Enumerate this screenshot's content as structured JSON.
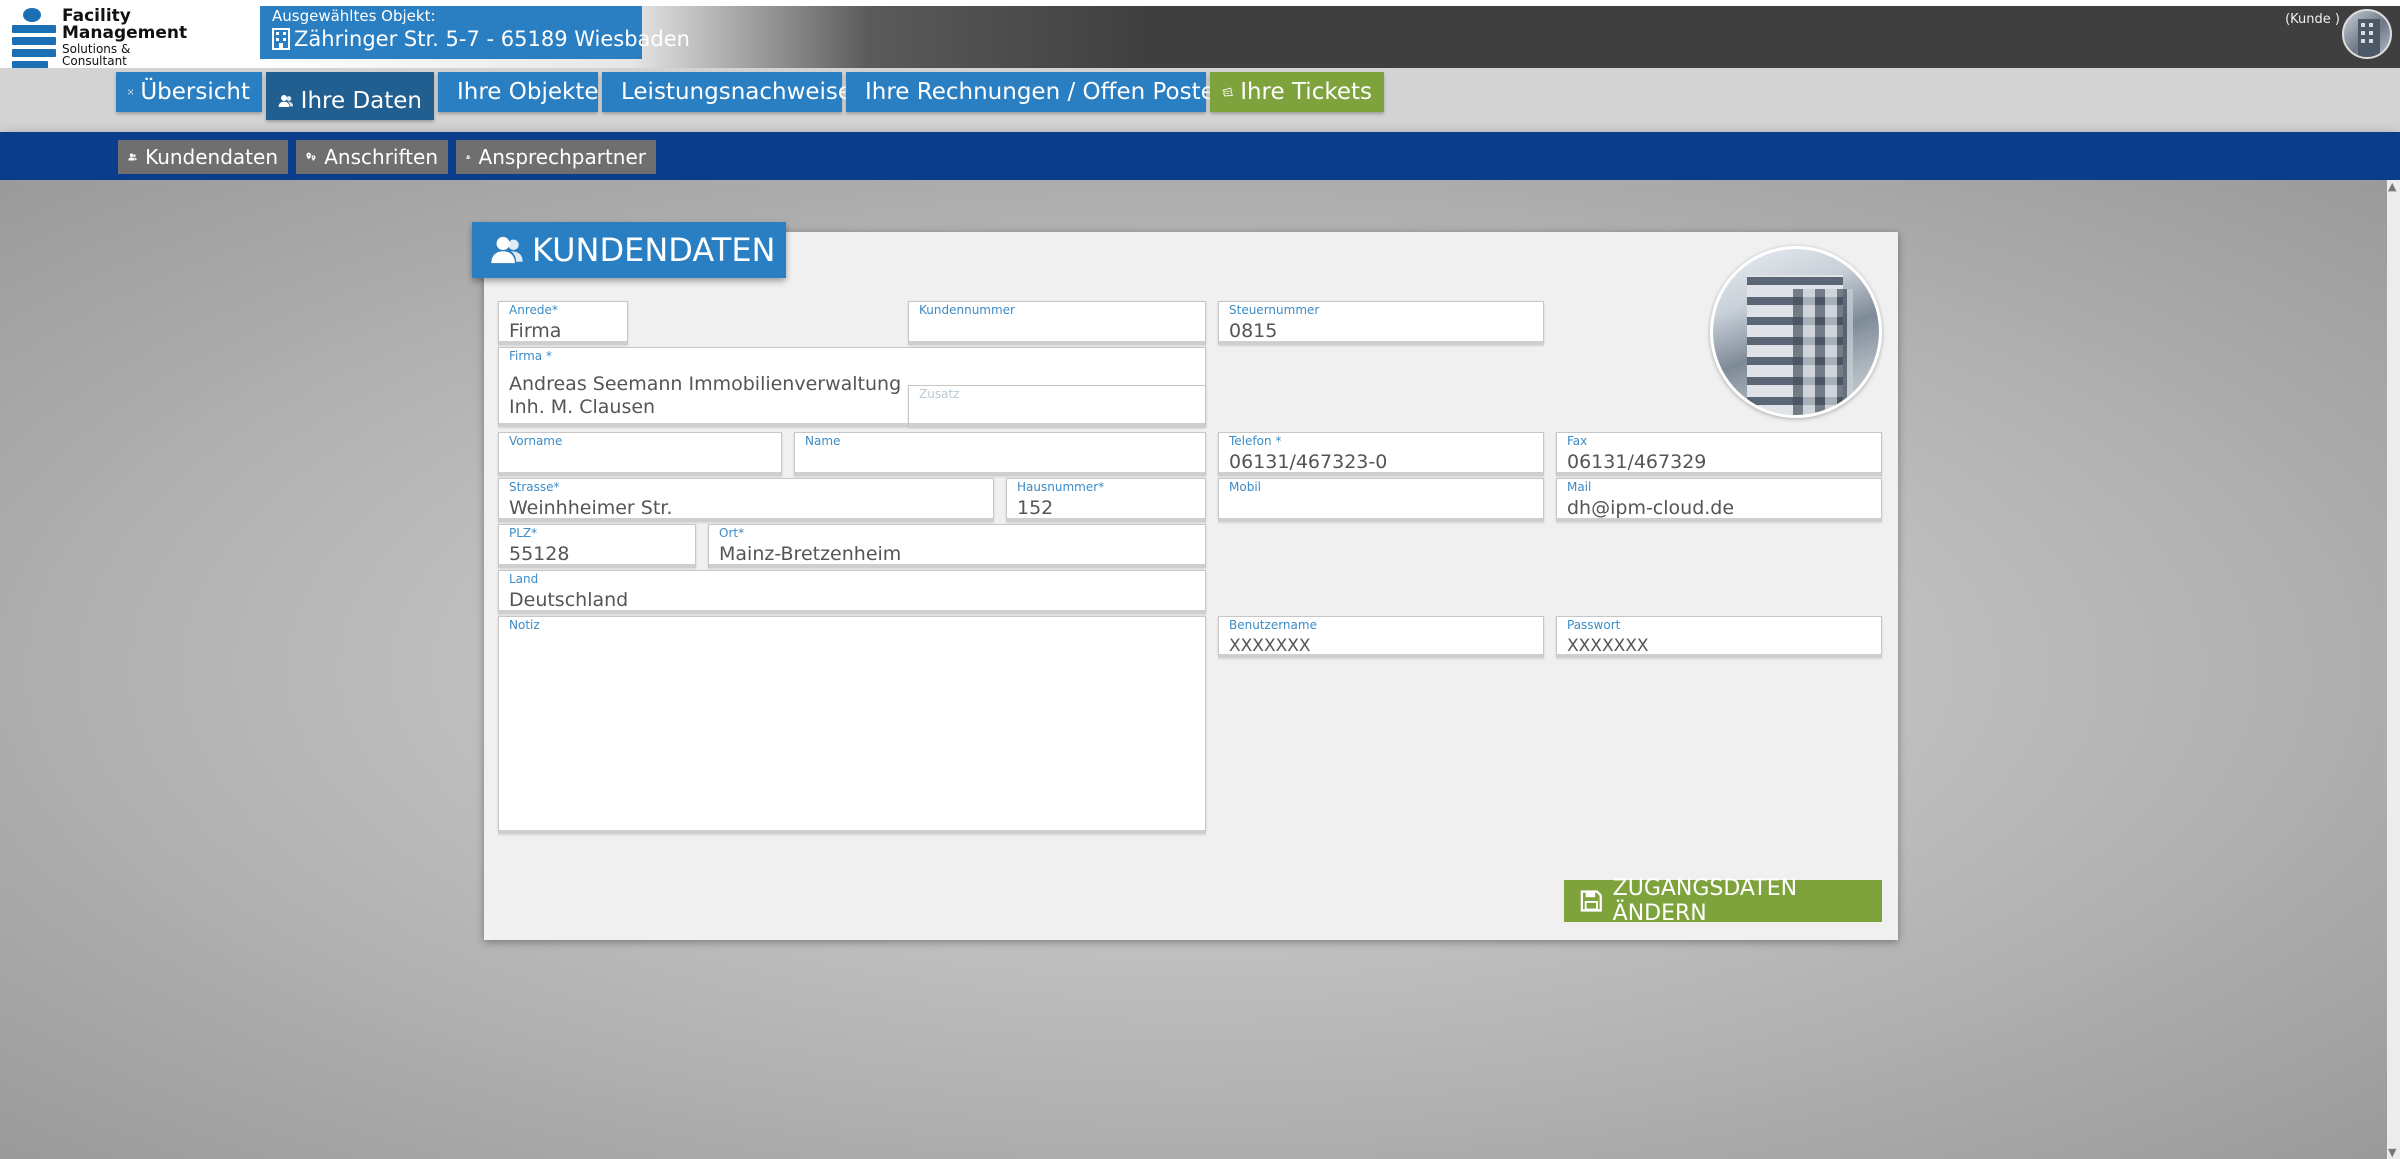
{
  "header": {
    "logo": {
      "line1": "Facility",
      "line2": "Management",
      "line3": "Solutions &",
      "line4": "Consultant"
    },
    "selected_object": {
      "label": "Ausgewähltes Objekt:",
      "value": "Zähringer Str. 5-7 - 65189 Wiesbaden"
    },
    "user_label": "(Kunde )"
  },
  "main_nav": {
    "tabs": [
      {
        "label": "Übersicht",
        "icon": "network-icon"
      },
      {
        "label": "Ihre Daten",
        "icon": "users-icon",
        "active": true
      },
      {
        "label": "Ihre Objekte",
        "icon": "building-icon"
      },
      {
        "label": "Leistungsnachweise",
        "icon": "document-icon"
      },
      {
        "label": "Ihre Rechnungen / Offen Posten",
        "icon": "coins-icon"
      },
      {
        "label": "Ihre Tickets",
        "icon": "ticket-icon"
      }
    ]
  },
  "sub_nav": {
    "tabs": [
      {
        "label": "Kundendaten",
        "icon": "users-icon"
      },
      {
        "label": "Anschriften",
        "icon": "map-pin-icon"
      },
      {
        "label": "Ansprechpartner",
        "icon": "users-icon"
      }
    ]
  },
  "panel": {
    "title": "KUNDENDATEN",
    "fields": {
      "anrede": {
        "label": "Anrede*",
        "value": "Firma"
      },
      "kundennummer": {
        "label": "Kundennummer",
        "value": ""
      },
      "steuernummer": {
        "label": "Steuernummer",
        "value": "0815"
      },
      "firma": {
        "label": "Firma *",
        "value_line1": "Andreas  Seemann Immobilienverwaltung",
        "value_line2": "Inh. M. Clausen"
      },
      "zusatz": {
        "label": "Zusatz",
        "value": ""
      },
      "vorname": {
        "label": "Vorname",
        "value": ""
      },
      "name": {
        "label": "Name",
        "value": ""
      },
      "telefon": {
        "label": "Telefon *",
        "value": "06131/467323-0"
      },
      "fax": {
        "label": "Fax",
        "value": "06131/467329"
      },
      "strasse": {
        "label": "Strasse*",
        "value": "Weinhheimer Str."
      },
      "hausnummer": {
        "label": "Hausnummer*",
        "value": "152"
      },
      "mobil": {
        "label": "Mobil",
        "value": ""
      },
      "mail": {
        "label": "Mail",
        "value": "dh@ipm-cloud.de"
      },
      "plz": {
        "label": "PLZ*",
        "value": "55128"
      },
      "ort": {
        "label": "Ort*",
        "value": "Mainz-Bretzenheim"
      },
      "land": {
        "label": "Land",
        "value": "Deutschland"
      },
      "notiz": {
        "label": "Notiz",
        "value": ""
      },
      "benutzername": {
        "label": "Benutzername",
        "value": "XXXXXXX"
      },
      "passwort": {
        "label": "Passwort",
        "value": "XXXXXXX"
      }
    },
    "save_button": "ZUGANGSDATEN ÄNDERN"
  },
  "colors": {
    "primary_blue": "#2a7ec2",
    "active_blue": "#215f91",
    "dark_navy": "#0c3d8c",
    "green": "#7ea23c",
    "label_blue": "#3b8cc7"
  }
}
